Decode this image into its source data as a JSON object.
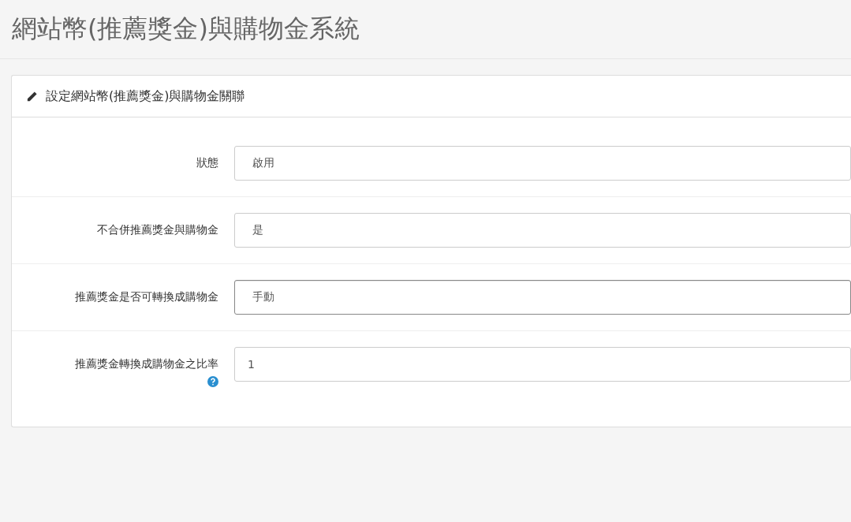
{
  "page": {
    "title": "網站幣(推薦獎金)與購物金系統"
  },
  "panel": {
    "heading": "設定網站幣(推薦獎金)與購物金關聯"
  },
  "fields": [
    {
      "label": "狀態",
      "kind": "select",
      "value": "啟用",
      "focused": false,
      "help": false
    },
    {
      "label": "不合併推薦獎金與購物金",
      "kind": "select",
      "value": "是",
      "focused": false,
      "help": false
    },
    {
      "label": "推薦獎金是否可轉換成購物金",
      "kind": "select",
      "value": "手動",
      "focused": true,
      "help": false
    },
    {
      "label": "推薦獎金轉換成購物金之比率",
      "kind": "input",
      "value": "1",
      "focused": false,
      "help": true
    }
  ]
}
